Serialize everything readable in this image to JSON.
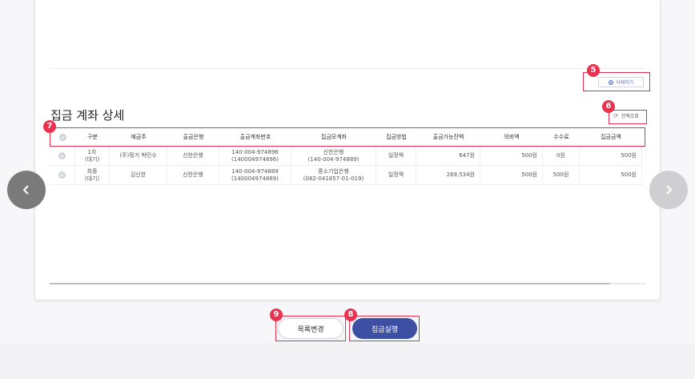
{
  "delete_button": {
    "label": "삭제하기"
  },
  "section": {
    "title": "집금 계좌 상세",
    "refresh_label": "잔액조회"
  },
  "badges": {
    "b5": "5",
    "b6": "6",
    "b7": "7",
    "b8": "8",
    "b9": "9"
  },
  "table": {
    "headers": [
      "구분",
      "예금주",
      "출금은행",
      "출금계좌번호",
      "집금모계좌",
      "집금방법",
      "출금가능잔액",
      "의뢰액",
      "수수료",
      "집금금액"
    ],
    "rows": [
      {
        "type": [
          "1차",
          "(대기)"
        ],
        "holder": "(주)핑거 박민수",
        "bank": "신한은행",
        "account": [
          "140-004-974896",
          "(140004974896)"
        ],
        "mother": [
          "신한은행",
          "(140-004-974889)"
        ],
        "method": "일정액",
        "available": "647원",
        "request": "500원",
        "fee": "0원",
        "amount": "500원"
      },
      {
        "type": [
          "최종",
          "(대기)"
        ],
        "holder": "김신한",
        "bank": "신한은행",
        "account": [
          "140-004-974889",
          "(140004974889)"
        ],
        "mother": [
          "중소기업은행",
          "(082-041857-01-019)"
        ],
        "method": "일정액",
        "available": "269,534원",
        "request": "500원",
        "fee": "500원",
        "amount": "500원"
      }
    ]
  },
  "nav": {
    "prev_icon": "chevron-left-icon",
    "next_icon": "chevron-right-icon"
  },
  "footer": {
    "list_change": "목록변경",
    "execute": "집금실행"
  },
  "colors": {
    "highlight": "#e0314f",
    "primary": "#3d4fa3"
  }
}
